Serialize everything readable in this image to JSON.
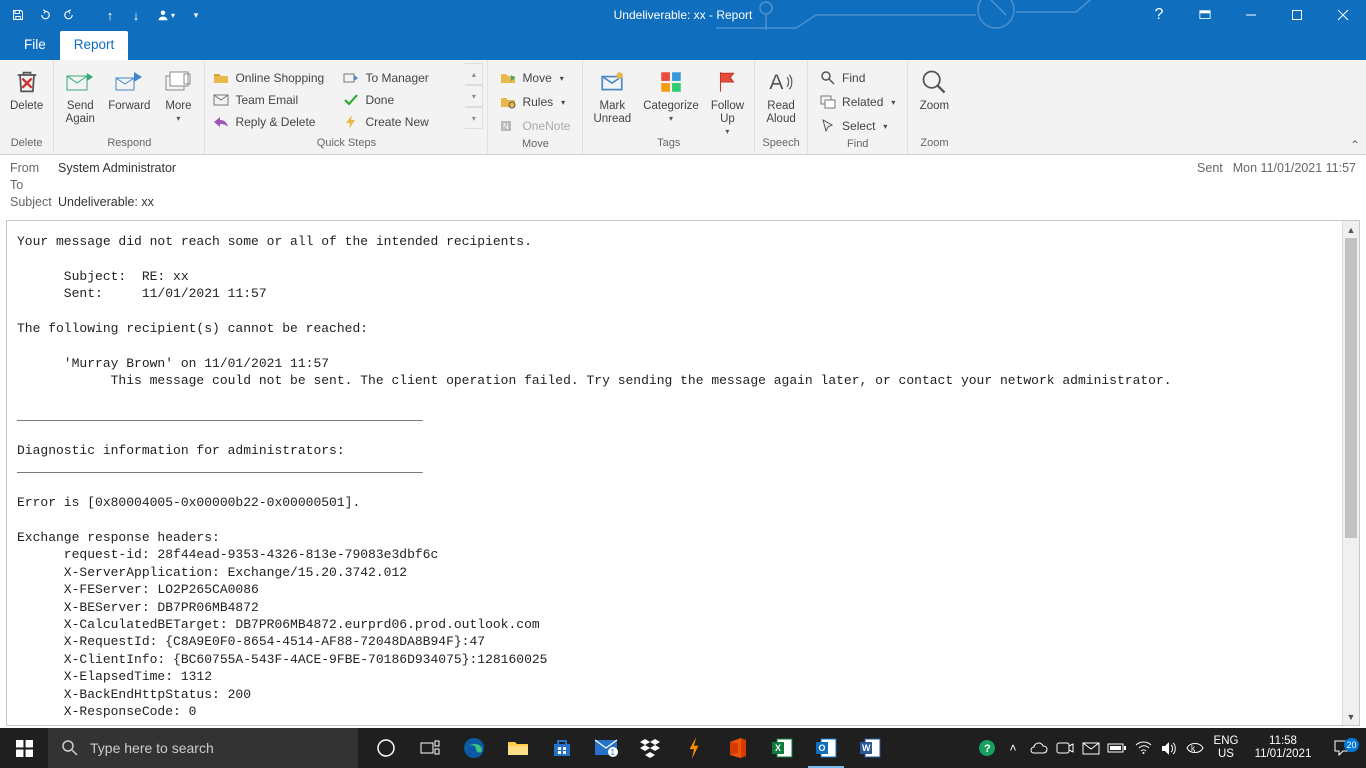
{
  "window": {
    "title": "Undeliverable: xx  -  Report"
  },
  "tabs": {
    "file": "File",
    "report": "Report"
  },
  "ribbon": {
    "delete": {
      "btn": "Delete",
      "group": "Delete"
    },
    "respond": {
      "send": "Send\nAgain",
      "forward": "Forward",
      "more": "More",
      "group": "Respond"
    },
    "quicksteps": {
      "items": [
        "Online Shopping",
        "To Manager",
        "Team Email",
        "Done",
        "Reply & Delete",
        "Create New"
      ],
      "group": "Quick Steps"
    },
    "move": {
      "move": "Move",
      "rules": "Rules",
      "onenote": "OneNote",
      "group": "Move"
    },
    "tags": {
      "unread": "Mark\nUnread",
      "categorize": "Categorize",
      "followup": "Follow\nUp",
      "group": "Tags"
    },
    "speech": {
      "read": "Read\nAloud",
      "group": "Speech"
    },
    "find": {
      "find": "Find",
      "related": "Related",
      "select": "Select",
      "group": "Find"
    },
    "zoom": {
      "zoom": "Zoom",
      "group": "Zoom"
    }
  },
  "header": {
    "from_k": "From",
    "from_v": "System Administrator",
    "to_k": "To",
    "to_v": "",
    "subject_k": "Subject",
    "subject_v": "Undeliverable: xx",
    "sent_k": "Sent",
    "sent_v": "Mon 11/01/2021 11:57"
  },
  "body": "Your message did not reach some or all of the intended recipients.\n\n      Subject:\tRE: xx\n      Sent:\t11/01/2021 11:57\n\nThe following recipient(s) cannot be reached:\n\n      'Murray Brown' on 11/01/2021 11:57\n            This message could not be sent. The client operation failed. Try sending the message again later, or contact your network administrator.\n\n____________________________________________________\n\nDiagnostic information for administrators:\n____________________________________________________\n\nError is [0x80004005-0x00000b22-0x00000501].\n\nExchange response headers:\n      request-id: 28f44ead-9353-4326-813e-79083e3dbf6c\n      X-ServerApplication: Exchange/15.20.3742.012\n      X-FEServer: LO2P265CA0086\n      X-BEServer: DB7PR06MB4872\n      X-CalculatedBETarget: DB7PR06MB4872.eurprd06.prod.outlook.com\n      X-RequestId: {C8A9E0F0-8654-4514-AF88-72048DA8B94F}:47\n      X-ClientInfo: {BC60755A-543F-4ACE-9FBE-70186D934075}:128160025\n      X-ElapsedTime: 1312\n      X-BackEndHttpStatus: 200\n      X-ResponseCode: 0",
  "taskbar": {
    "search": "Type here to search",
    "lang1": "ENG",
    "lang2": "US",
    "time": "11:58",
    "date": "11/01/2021",
    "notif": "20"
  }
}
